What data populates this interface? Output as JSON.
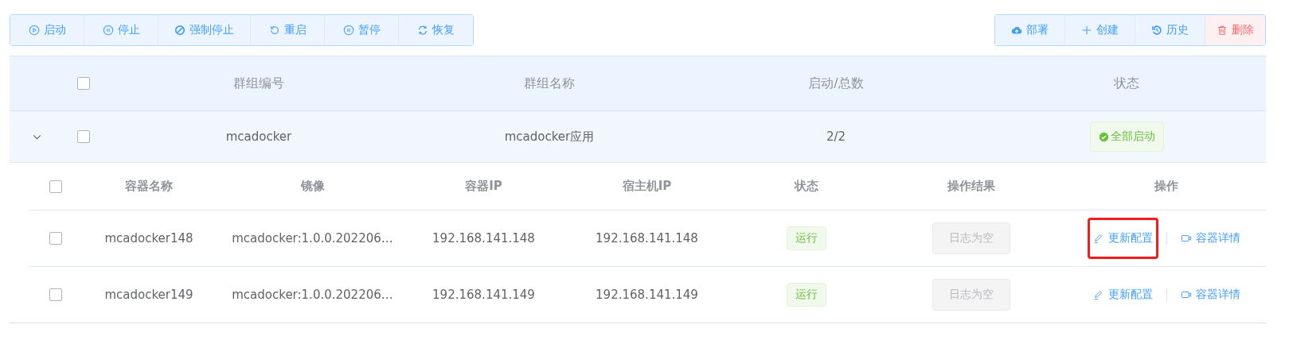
{
  "toolbar_left": [
    {
      "label": "启动"
    },
    {
      "label": "停止"
    },
    {
      "label": "强制停止"
    },
    {
      "label": "重启"
    },
    {
      "label": "暂停"
    },
    {
      "label": "恢复"
    }
  ],
  "toolbar_right": [
    {
      "label": "部署",
      "kind": "primary"
    },
    {
      "label": "创建",
      "kind": "primary"
    },
    {
      "label": "历史",
      "kind": "primary"
    },
    {
      "label": "删除",
      "kind": "danger"
    }
  ],
  "group_table": {
    "select_all_checked": false,
    "columns": [
      "群组编号",
      "群组名称",
      "启动/总数",
      "状态"
    ],
    "rows": [
      {
        "expanded": true,
        "checked": false,
        "id": "mcadocker",
        "name": "mcadocker应用",
        "count": "2/2",
        "status": "全部启动",
        "containers": {
          "select_all_checked": false,
          "columns": [
            "容器名称",
            "镜像",
            "容器IP",
            "宿主机IP",
            "状态",
            "操作结果",
            "操作"
          ],
          "rows": [
            {
              "checked": false,
              "name": "mcadocker148",
              "image": "mcadocker:1.0.0.202206…",
              "container_ip": "192.168.141.148",
              "host_ip": "192.168.141.148",
              "status": "运行",
              "result": "日志为空",
              "actions": [
                {
                  "label": "更新配置",
                  "highlighted": true
                },
                {
                  "label": "容器详情",
                  "highlighted": false
                }
              ]
            },
            {
              "checked": false,
              "name": "mcadocker149",
              "image": "mcadocker:1.0.0.202206…",
              "container_ip": "192.168.141.149",
              "host_ip": "192.168.141.149",
              "status": "运行",
              "result": "日志为空",
              "actions": [
                {
                  "label": "更新配置",
                  "highlighted": false
                },
                {
                  "label": "容器详情",
                  "highlighted": false
                }
              ]
            }
          ]
        }
      }
    ]
  }
}
